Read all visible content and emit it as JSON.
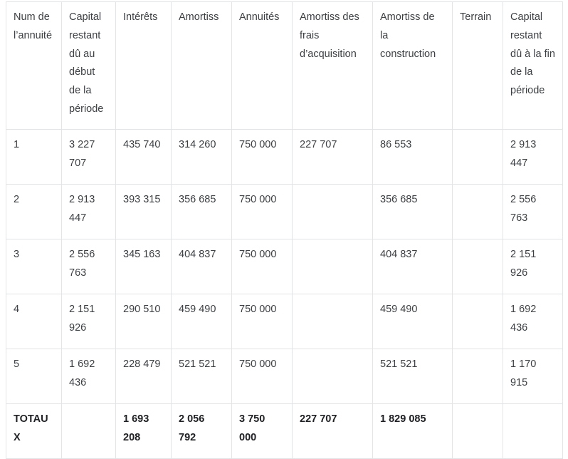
{
  "table": {
    "name": "tableau-amortissement",
    "columns": [
      "Num de l’annuité",
      "Capital restant dû au début de la période",
      "Intérêts",
      "Amortiss",
      "Annuités",
      "Amortiss des frais d’acquisition",
      "Amortiss de la construction",
      "Terrain",
      "Capital restant dû à la fin de la période"
    ],
    "rows": [
      {
        "num": "1",
        "capital_debut": "3 227 707",
        "interets": "435 740",
        "amortiss": "314 260",
        "annuites": "750 000",
        "amortiss_frais": "227 707",
        "amortiss_construction": "86 553",
        "terrain": "",
        "capital_fin": "2 913 447"
      },
      {
        "num": "2",
        "capital_debut": "2 913 447",
        "interets": "393 315",
        "amortiss": "356 685",
        "annuites": "750 000",
        "amortiss_frais": "",
        "amortiss_construction": "356 685",
        "terrain": "",
        "capital_fin": "2 556 763"
      },
      {
        "num": "3",
        "capital_debut": "2 556 763",
        "interets": "345 163",
        "amortiss": "404 837",
        "annuites": "750 000",
        "amortiss_frais": "",
        "amortiss_construction": "404 837",
        "terrain": "",
        "capital_fin": "2 151 926"
      },
      {
        "num": "4",
        "capital_debut": "2 151 926",
        "interets": "290 510",
        "amortiss": "459 490",
        "annuites": "750 000",
        "amortiss_frais": "",
        "amortiss_construction": "459 490",
        "terrain": "",
        "capital_fin": "1 692 436"
      },
      {
        "num": "5",
        "capital_debut": "1 692 436",
        "interets": "228 479",
        "amortiss": "521 521",
        "annuites": "750 000",
        "amortiss_frais": "",
        "amortiss_construction": "521 521",
        "terrain": "",
        "capital_fin": "1 170 915"
      }
    ],
    "totals": {
      "num": "TOTAUX",
      "capital_debut": "",
      "interets": "1 693 208",
      "amortiss": "2 056 792",
      "annuites": "3 750 000",
      "amortiss_frais": "227 707",
      "amortiss_construction": "1 829 085",
      "terrain": "",
      "capital_fin": ""
    }
  },
  "colors": {
    "text": "#3c4043",
    "text_strong": "#202124",
    "border": "#e3e4e6",
    "background": "#ffffff"
  }
}
